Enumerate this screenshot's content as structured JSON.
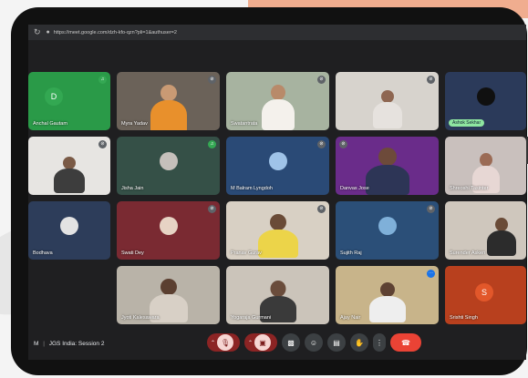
{
  "browser": {
    "url": "https://meet.google.com/dzh-kfo-qzn?pli=1&authuser=2",
    "reload_icon": "reload-icon",
    "lock_icon": "lock-icon"
  },
  "participants": [
    {
      "name": "Anchal Gautam",
      "initial": "D",
      "mic": "green"
    },
    {
      "name": "Myra Yadav",
      "mic": "grey"
    },
    {
      "name": "Swatantrata",
      "mic": "grey"
    },
    {
      "name": "",
      "mic": "grey"
    },
    {
      "name": "Ashok Sekhar",
      "mic": "",
      "badge": true
    },
    {
      "name": "",
      "mic": "grey"
    },
    {
      "name": "Jisha Jain",
      "mic": "green"
    },
    {
      "name": "M Balram Lyngdoh",
      "mic": "grey"
    },
    {
      "name": "Danvas Jose",
      "mic": "grey"
    },
    {
      "name": "Shreoshi Tasinter",
      "mic": ""
    },
    {
      "name": "Bodhava",
      "mic": ""
    },
    {
      "name": "Swati Dey",
      "mic": "grey"
    },
    {
      "name": "Pranav Gurav",
      "mic": "grey"
    },
    {
      "name": "Sujith Raj",
      "mic": "grey"
    },
    {
      "name": "Surender Asken",
      "mic": ""
    },
    {
      "name": "Jyoti Kalesawara",
      "mic": ""
    },
    {
      "name": "Yogaraja Gurmani",
      "mic": ""
    },
    {
      "name": "Ajay Nair",
      "mic": "grey"
    },
    {
      "name": "Srishti Singh",
      "initial": "S",
      "mic": ""
    }
  ],
  "meeting": {
    "time": "M",
    "separator": "|",
    "title": "JGS India: Session 2"
  },
  "controls": {
    "mic": "mic-off-icon",
    "camera": "camera-off-icon",
    "present": "present-icon",
    "emoji": "emoji-icon",
    "captions": "captions-icon",
    "hand": "raise-hand-icon",
    "more": "more-options-icon",
    "end": "end-call-icon"
  },
  "colors": {
    "end_call": "#ea4335",
    "muted_control": "#8c2424",
    "active_mic": "#34a853",
    "meet_background": "#1f1f21"
  }
}
